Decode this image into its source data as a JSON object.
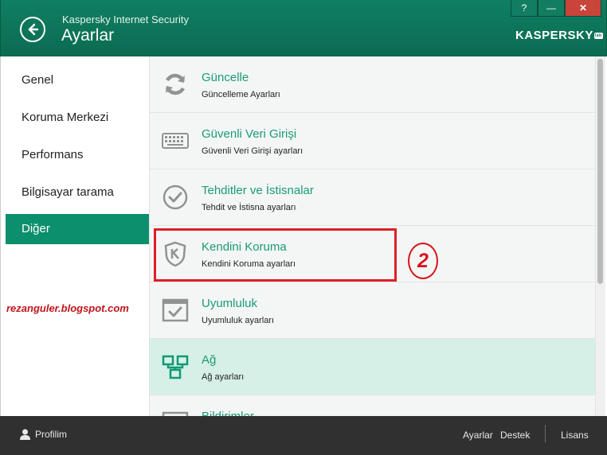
{
  "window": {
    "app_name": "Kaspersky Internet Security",
    "page_title": "Ayarlar",
    "brand": "KASPERSKY",
    "brand_suffix": "lab",
    "controls": {
      "help": "?",
      "minimize": "—",
      "close": "✕"
    }
  },
  "sidebar": {
    "items": [
      {
        "label": "Genel",
        "active": false
      },
      {
        "label": "Koruma Merkezi",
        "active": false
      },
      {
        "label": "Performans",
        "active": false
      },
      {
        "label": "Bilgisayar tarama",
        "active": false
      },
      {
        "label": "Diğer",
        "active": true
      }
    ]
  },
  "watermark": "rezanguler.blogspot.com",
  "settings": [
    {
      "title": "Güncelle",
      "subtitle": "Güncelleme Ayarları",
      "icon": "update-icon"
    },
    {
      "title": "Güvenli Veri Girişi",
      "subtitle": "Güvenli Veri Girişi ayarları",
      "icon": "keyboard-icon"
    },
    {
      "title": "Tehditler ve İstisnalar",
      "subtitle": "Tehdit ve İstisna ayarları",
      "icon": "checkmark-icon"
    },
    {
      "title": "Kendini Koruma",
      "subtitle": "Kendini Koruma ayarları",
      "icon": "shield-icon"
    },
    {
      "title": "Uyumluluk",
      "subtitle": "Uyumluluk ayarları",
      "icon": "compatibility-icon"
    },
    {
      "title": "Ağ",
      "subtitle": "Ağ ayarları",
      "icon": "network-icon"
    },
    {
      "title": "Bildirimler",
      "subtitle": "",
      "icon": "notifications-icon"
    }
  ],
  "annotation": {
    "number": "2"
  },
  "footer": {
    "profile": "Profilim",
    "settings": "Ayarlar",
    "support": "Destek",
    "license": "Lisans"
  },
  "colors": {
    "header_green": "#0c6e55",
    "accent_green": "#1a9a76",
    "active_nav": "#0c8f6c",
    "annotation_red": "#e01e28"
  }
}
